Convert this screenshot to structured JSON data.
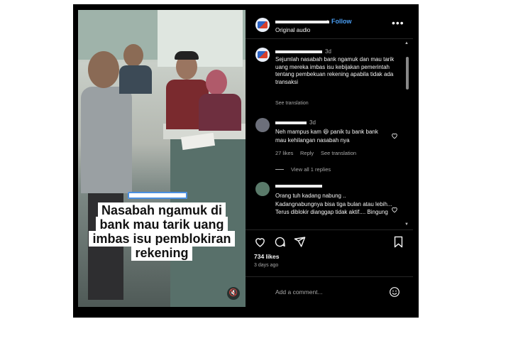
{
  "header": {
    "follow_label": "Follow",
    "audio_label": "Original audio"
  },
  "post": {
    "time": "3d",
    "caption": "Sejumlah nasabah bank ngamuk dan mau tarik uang mereka imbas isu kebijakan pemerintah tentang pembekuan rekening apabila tidak ada transaksi",
    "see_translation": "See translation"
  },
  "comments": [
    {
      "time": "3d",
      "text": "Neh mampus kam 😆 panik tu bank bank mau kehilangan nasabah nya",
      "likes": "27 likes",
      "reply": "Reply",
      "see_translation": "See translation",
      "view_replies": "View all 1 replies"
    },
    {
      "text": "Orang tuh kadang nabung .. Kadangnabungnya bisa tiga bulan atau lebih... Terus diblokir dianggap tidak aktif.... Bingung"
    }
  ],
  "video": {
    "caption": "Nasabah ngamuk di bank mau tarik uang imbas isu pemblokiran rekening"
  },
  "actions": {
    "likes": "734 likes",
    "posted": "3 days ago",
    "comment_placeholder": "Add a comment..."
  },
  "colors": {
    "accent": "#4a9ff5",
    "panel_bg": "#000000"
  }
}
